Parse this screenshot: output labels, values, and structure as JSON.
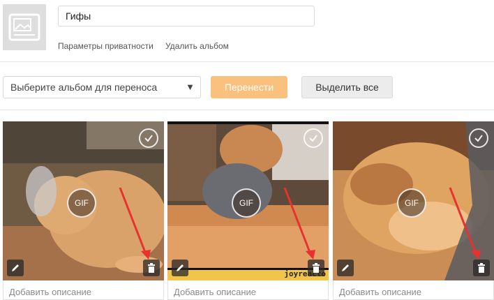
{
  "album": {
    "title_value": "Гифы",
    "links": {
      "privacy": "Параметры приватности",
      "delete": "Удалить альбом"
    }
  },
  "toolbar": {
    "select_placeholder": "Выберите альбом для переноса",
    "move_label": "Перенести",
    "select_all_label": "Выделить все"
  },
  "photos": [
    {
      "badge": "GIF",
      "description_placeholder": "Добавить описание"
    },
    {
      "badge": "GIF",
      "description_placeholder": "Добавить описание",
      "watermark": "joyreacto"
    },
    {
      "badge": "GIF",
      "description_placeholder": "Добавить описание"
    }
  ],
  "colors": {
    "move_button": "#f9c17d",
    "arrow_annotation": "#e8322d"
  },
  "icons": [
    "image-placeholder-icon",
    "dropdown-arrow-icon",
    "check-circle-icon",
    "pencil-icon",
    "trash-icon"
  ]
}
